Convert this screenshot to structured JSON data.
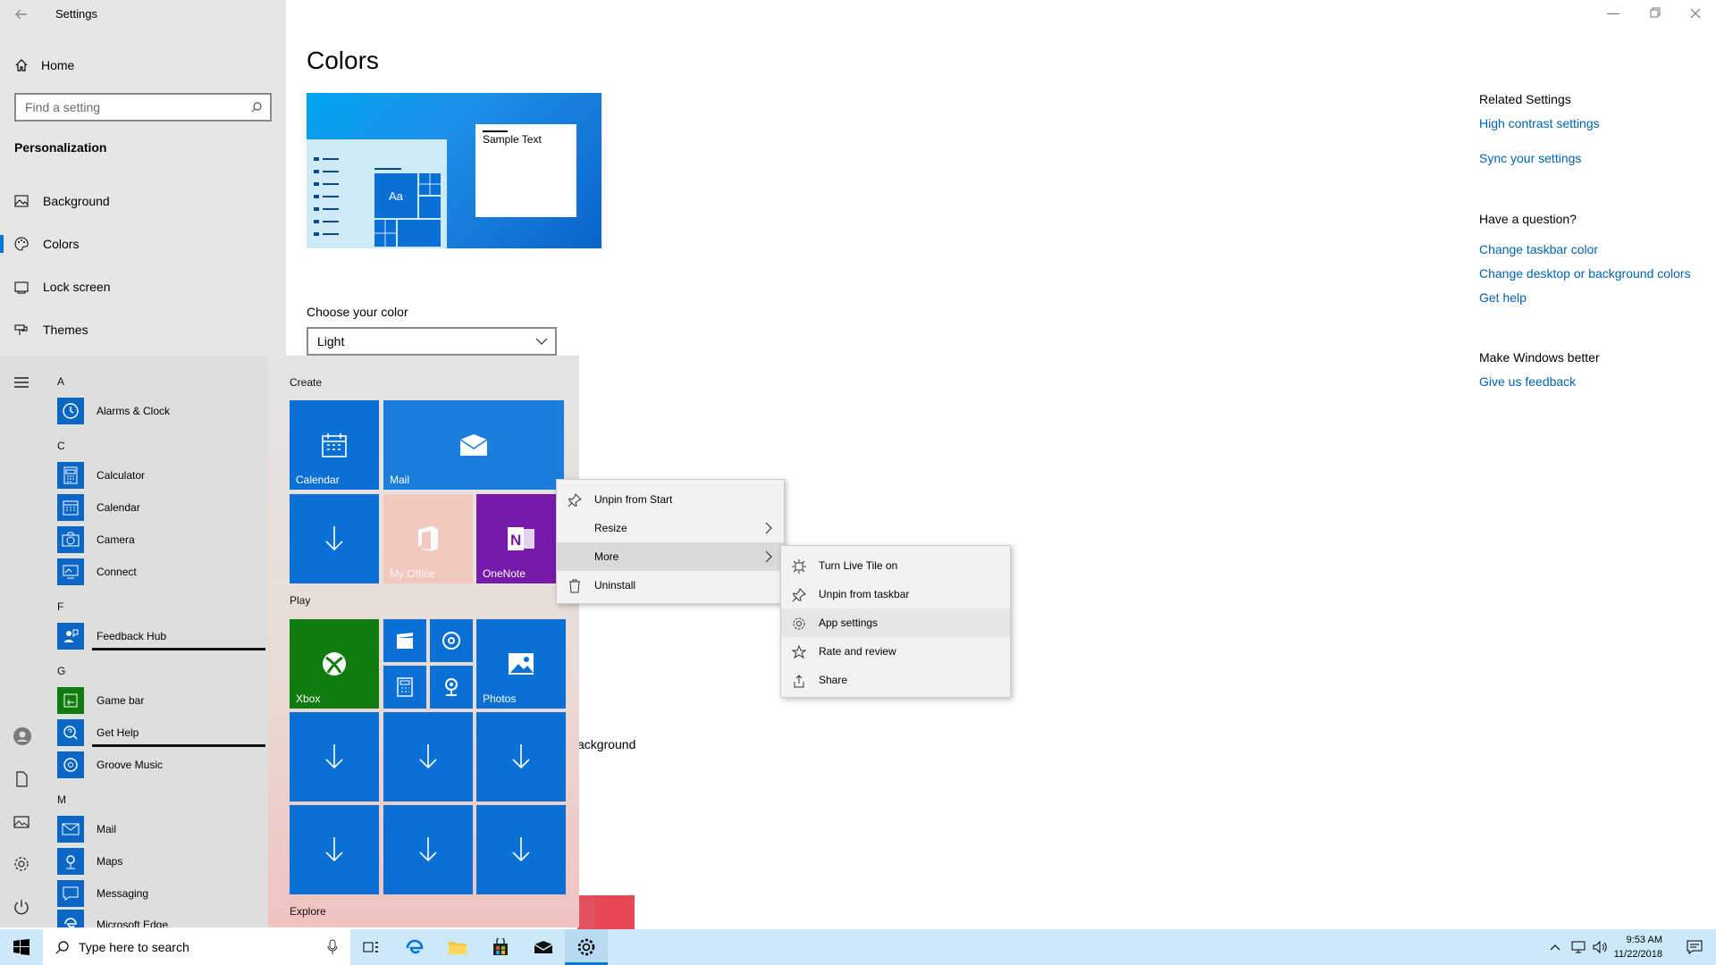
{
  "settings": {
    "window_title": "Settings",
    "home_label": "Home",
    "search_placeholder": "Find a setting",
    "section_title": "Personalization",
    "nav": [
      {
        "label": "Background",
        "icon": "picture-icon"
      },
      {
        "label": "Colors",
        "icon": "palette-icon",
        "selected": true
      },
      {
        "label": "Lock screen",
        "icon": "lock-screen-icon"
      },
      {
        "label": "Themes",
        "icon": "brush-icon"
      }
    ],
    "page_title": "Colors",
    "preview_sample_text": "Sample Text",
    "preview_tile_text": "Aa",
    "choose_color_label": "Choose your color",
    "choose_color_value": "Light",
    "partial_text": "ackground",
    "related_settings_title": "Related Settings",
    "related_links": [
      "High contrast settings",
      "Sync your settings"
    ],
    "question_title": "Have a question?",
    "question_links": [
      "Change taskbar color",
      "Change desktop or background colors",
      "Get help"
    ],
    "better_title": "Make Windows better",
    "better_link": "Give us feedback",
    "accent_color": "#0078d7",
    "link_color": "#0063b1"
  },
  "start_menu": {
    "letters": [
      "A",
      "C",
      "F",
      "G",
      "M"
    ],
    "apps": {
      "alarms": "Alarms & Clock",
      "calculator": "Calculator",
      "calendar": "Calendar",
      "camera": "Camera",
      "connect": "Connect",
      "feedback": "Feedback Hub",
      "gamebar": "Game bar",
      "gethelp": "Get Help",
      "groove": "Groove Music",
      "mail": "Mail",
      "maps": "Maps",
      "messaging": "Messaging",
      "edge": "Microsoft Edge"
    },
    "groups": {
      "create": "Create",
      "play": "Play",
      "explore": "Explore"
    },
    "tiles": {
      "calendar": "Calendar",
      "mail": "Mail",
      "myoffice": "My Office",
      "onenote": "OneNote",
      "xbox": "Xbox",
      "photos": "Photos"
    }
  },
  "context_menu": {
    "items": [
      "Unpin from Start",
      "Resize",
      "More",
      "Uninstall"
    ]
  },
  "submenu": {
    "items": [
      "Turn Live Tile on",
      "Unpin from taskbar",
      "App settings",
      "Rate and review",
      "Share"
    ]
  },
  "taskbar": {
    "search_placeholder": "Type here to search",
    "time": "9:53 AM",
    "date": "11/22/2018",
    "bar_color": "#cde8f8"
  }
}
